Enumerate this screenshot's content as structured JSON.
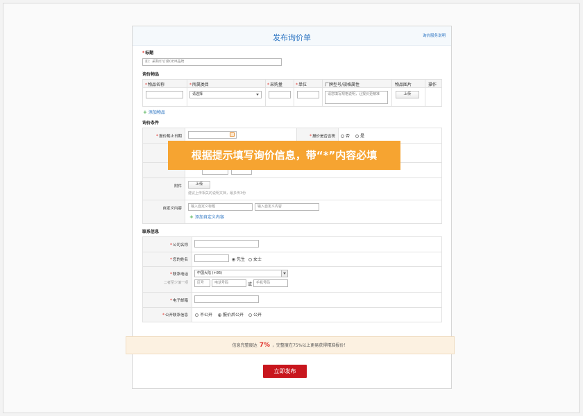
{
  "header": {
    "title": "发布询价单",
    "help_link": "询价服务说明"
  },
  "title_field": {
    "label": "标题",
    "placeholder": "如：采购印订做OEM品牌"
  },
  "items": {
    "section": "询价物品",
    "columns": [
      "物品名称",
      "所属类目",
      "采购量",
      "单位",
      "厂牌型号/规格属性",
      "物品图片",
      "操作"
    ],
    "category_select": "请选择",
    "spec_placeholder": "请您填写规格说明，让报价更精准",
    "upload": "上传",
    "add_item": "添加物品"
  },
  "conditions": {
    "section": "询价条件",
    "deadline_label": "报价截止日期",
    "tax_label": "报价是否含税",
    "tax_options": [
      "否",
      "是"
    ],
    "attachment_label": "附件",
    "attachment_upload": "上传",
    "attachment_hint": "建议上传相关的说明文档，最多传3份",
    "custom_label": "自定义内容",
    "custom_title_placeholder": "输入自定义标题",
    "custom_content_placeholder": "输入自定义内容",
    "add_custom": "添加自定义内容"
  },
  "overlay": {
    "text": "根据提示填写询价信息，带“*”内容必填"
  },
  "contact": {
    "section": "联系信息",
    "company_label": "公司名称",
    "name_label": "您的姓名",
    "gender_options": [
      "先生",
      "女士"
    ],
    "phone_label": "联系电话",
    "phone_hint": "二者至少填一项",
    "country_select": "中国大陆 (+86)",
    "area_placeholder": "区号",
    "tel_placeholder": "电话号码",
    "or_text": "或",
    "mobile_placeholder": "手机号码",
    "email_label": "电子邮箱",
    "public_label": "公开联系信息",
    "public_options": [
      "不公开",
      "报价后公开",
      "公开"
    ]
  },
  "progress": {
    "prefix": "信息完整度达",
    "percent": "7%",
    "suffix": "，完整度在75%以上更易获得精准报价！",
    "value": 7
  },
  "submit": {
    "label": "立即发布"
  }
}
